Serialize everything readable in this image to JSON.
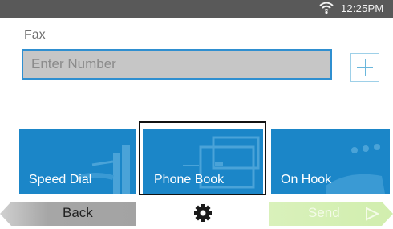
{
  "status": {
    "time": "12:25PM"
  },
  "screen": {
    "title": "Fax"
  },
  "number_input": {
    "placeholder": "Enter Number",
    "value": ""
  },
  "tiles": [
    {
      "label": "Speed Dial"
    },
    {
      "label": "Phone Book"
    },
    {
      "label": "On Hook"
    }
  ],
  "footer": {
    "back_label": "Back",
    "send_label": "Send"
  },
  "icons": {
    "status": "wifi-icon",
    "add": "plus-icon",
    "settings": "gear-icon",
    "send": "triangle-right-icon"
  },
  "colors": {
    "tile_blue": "#1b86c8",
    "field_border": "#2f8fd0",
    "send_disabled": "#d5efb3",
    "back_gray": "#a3a3a3"
  }
}
